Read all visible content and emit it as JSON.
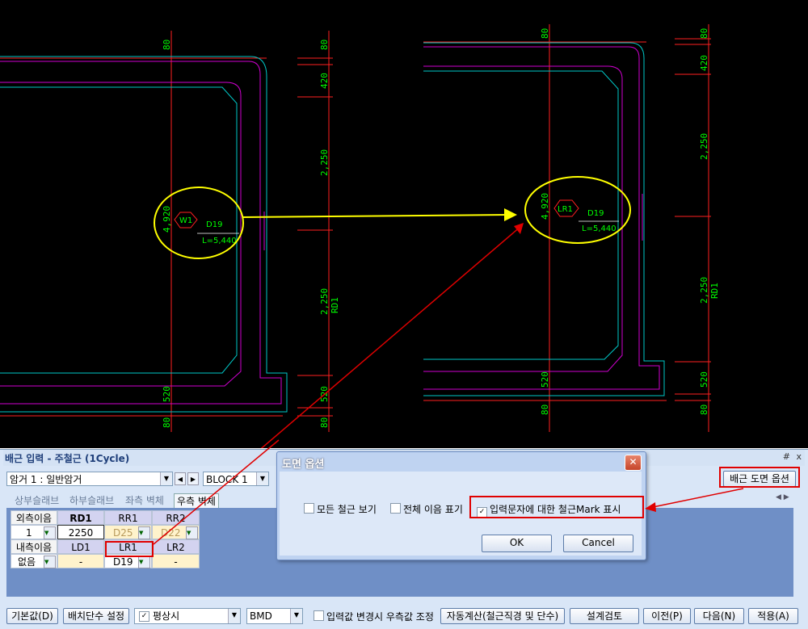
{
  "drawing": {
    "left": {
      "dims": [
        "80",
        "420",
        "2,250",
        "2,250",
        "520",
        "80"
      ],
      "height_label": "4,920",
      "bar_mark": "W1",
      "bar_dia": "D19",
      "bar_len": "L=5,440",
      "section": "RD1"
    },
    "right": {
      "dims": [
        "80",
        "420",
        "2,250",
        "2,250",
        "520",
        "80"
      ],
      "height_label": "4,920",
      "bar_mark": "LR1",
      "bar_dia": "D19",
      "bar_len": "L=5,440",
      "section": "RD1"
    }
  },
  "panel": {
    "title": "배근 입력 - 주철근 (1Cycle)",
    "pin": "#",
    "close": "x",
    "culvert_select": "암거 1 : 일반암거",
    "block_select": "BLOCK  1",
    "rebar_option_btn": "배근 도면 옵션",
    "tabs": [
      "상부슬래브",
      "하부슬래브",
      "좌측 벽체",
      "우측 벽체"
    ],
    "grid": {
      "row1": [
        "외측이음",
        "RD1",
        "RR1",
        "RR2"
      ],
      "row2": [
        "1",
        "2250",
        "D25",
        "D22"
      ],
      "row3": [
        "내측이음",
        "LD1",
        "LR1",
        "LR2"
      ],
      "row4": [
        "없음",
        "-",
        "D19",
        "-"
      ]
    },
    "buttons": {
      "default": "기본값(D)",
      "layer": "배치단수 설정",
      "mode": "평상시",
      "code": "BMD",
      "auto_adjust": "입력값 변경시 우측값 조정",
      "autocalc": "자동계산(철근직경 및 단수)",
      "review": "설계검토",
      "prev": "이전(P)",
      "next": "다음(N)",
      "apply": "적용(A)"
    }
  },
  "dialog": {
    "title": "도면 옵션",
    "opt_all": "모든 철근 보기",
    "opt_splice": "전체 이음 표기",
    "opt_mark": "입력문자에 대한 철근Mark 표시",
    "ok": "OK",
    "cancel": "Cancel"
  },
  "colors": {
    "dim_line": "#ff0000",
    "dim_text": "#00ff00",
    "outline": "#00c8c8",
    "rebar": "#d000d0",
    "highlight": "#ffff00",
    "annotation": "#e00000"
  }
}
